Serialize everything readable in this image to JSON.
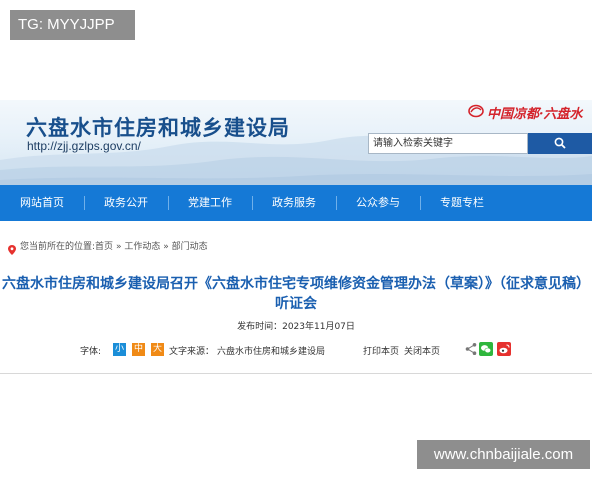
{
  "overlay": {
    "tag": "TG: MYYJJPP",
    "watermark": "www.chnbaijiale.com"
  },
  "header": {
    "site_title": "六盘水市住房和城乡建设局",
    "url": "http://zjj.gzlps.gov.cn/",
    "logo_text": "中国凉都·六盘水",
    "search_placeholder": "请输入检索关键字"
  },
  "nav": {
    "items": [
      {
        "label": "网站首页"
      },
      {
        "label": "政务公开"
      },
      {
        "label": "党建工作"
      },
      {
        "label": "政务服务"
      },
      {
        "label": "公众参与"
      },
      {
        "label": "专题专栏"
      }
    ]
  },
  "breadcrumb": {
    "prefix": "您当前所在的位置:",
    "items": [
      "首页",
      "工作动态",
      "部门动态"
    ],
    "separator": "»"
  },
  "article": {
    "title": "六盘水市住房和城乡建设局召开《六盘水市住宅专项维修资金管理办法（草案）》（征求意见稿）听证会",
    "date_label": "发布时间：",
    "date": "2023年11月07日",
    "font_label": "字体:",
    "font_small": "小",
    "font_medium": "中",
    "font_large": "大",
    "source_label": "文字来源：",
    "source": "六盘水市住房和城乡建设局",
    "print": "打印本页",
    "close": "关闭本页"
  },
  "colors": {
    "nav_bg": "#1579d6",
    "title_blue": "#184f8c",
    "article_title": "#1a5fb0",
    "logo_red": "#d4232b",
    "font_small": "#1b8ed8",
    "font_medium": "#f08a16",
    "font_large": "#f08a16",
    "wechat": "#2fb63d",
    "weibo": "#e6312e"
  },
  "icons": [
    "location-pin-icon",
    "search-icon",
    "share-icon",
    "wechat-icon",
    "weibo-icon",
    "logo-mark-icon"
  ]
}
